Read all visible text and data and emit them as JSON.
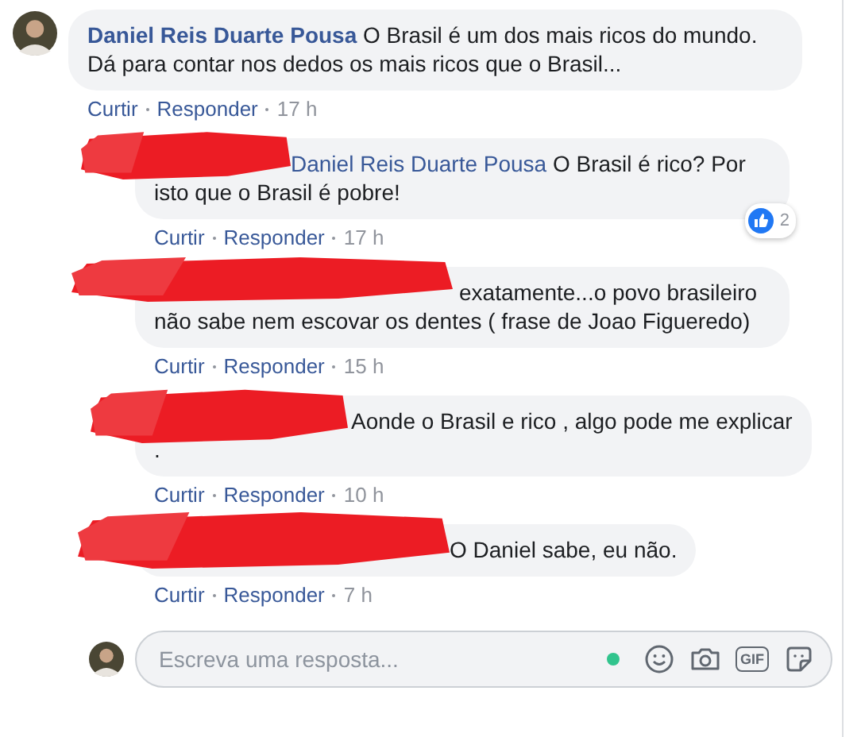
{
  "comment": {
    "author": "Daniel Reis Duarte Pousa",
    "text": "O Brasil é um dos mais ricos do mundo. Dá para contar nos dedos os mais ricos que o Brasil...",
    "like": "Curtir",
    "reply": "Responder",
    "time": "17 h"
  },
  "replies": [
    {
      "redacted": true,
      "mention": "Daniel Reis Duarte Pousa",
      "text": "O Brasil é rico? Por isto que o Brasil é pobre!",
      "like": "Curtir",
      "reply": "Responder",
      "time": "17 h",
      "reactions": "2"
    },
    {
      "redacted": true,
      "text": "exatamente...o povo brasileiro não sabe nem escovar os dentes ( frase de Joao Figueredo)",
      "like": "Curtir",
      "reply": "Responder",
      "time": "15 h"
    },
    {
      "redacted": true,
      "text": "Aonde o Brasil e rico , algo pode me explicar\n.",
      "like": "Curtir",
      "reply": "Responder",
      "time": "10 h"
    },
    {
      "redacted": true,
      "text": "O Daniel sabe, eu não.",
      "like": "Curtir",
      "reply": "Responder",
      "time": "7 h"
    }
  ],
  "composer": {
    "placeholder": "Escreva uma resposta...",
    "online": true,
    "gif_label": "GIF"
  }
}
